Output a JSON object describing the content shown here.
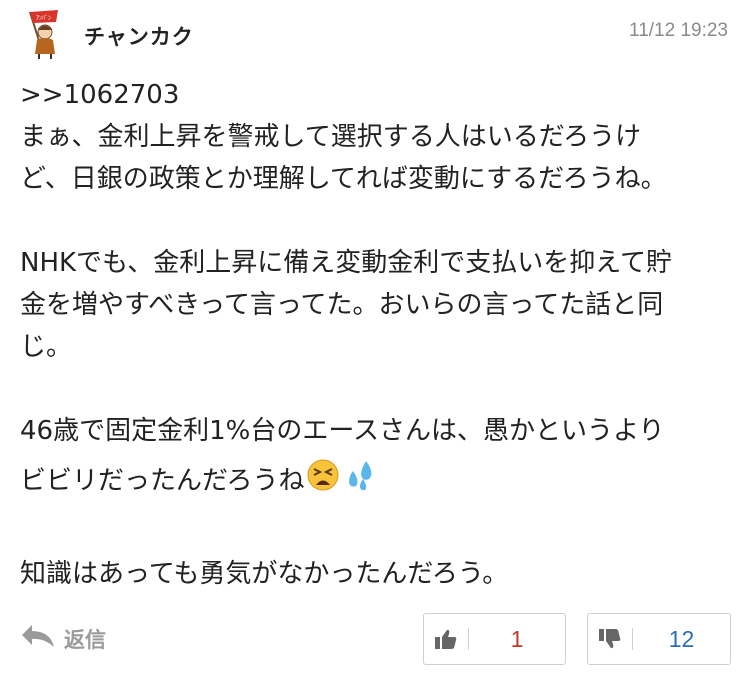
{
  "comment": {
    "username": "チャンカク",
    "timestamp": "11/12 19:23",
    "lines": [
      ">>1062703",
      "まぁ、金利上昇を警戒して選択する人はいるだろうけ",
      "ど、日銀の政策とか理解してれば変動にするだろうね。",
      "",
      "NHKでも、金利上昇に備え変動金利で支払いを抑えて貯",
      "金を増やすべきって言ってた。おいらの言ってた話と同",
      "じ。",
      "",
      "46歳で固定金利1%台のエースさんは、愚かというより",
      "ビビリだったんだろうね",
      "",
      "知識はあっても勇気がなかったんだろう。"
    ],
    "emoji_names": [
      "tired-face-emoji",
      "sweat-droplets-emoji"
    ]
  },
  "actions": {
    "reply_label": "返信",
    "like_count": "1",
    "dislike_count": "12"
  },
  "colors": {
    "like": "#c0392b",
    "dislike": "#2a6fb3",
    "muted": "#9a9a9a"
  }
}
